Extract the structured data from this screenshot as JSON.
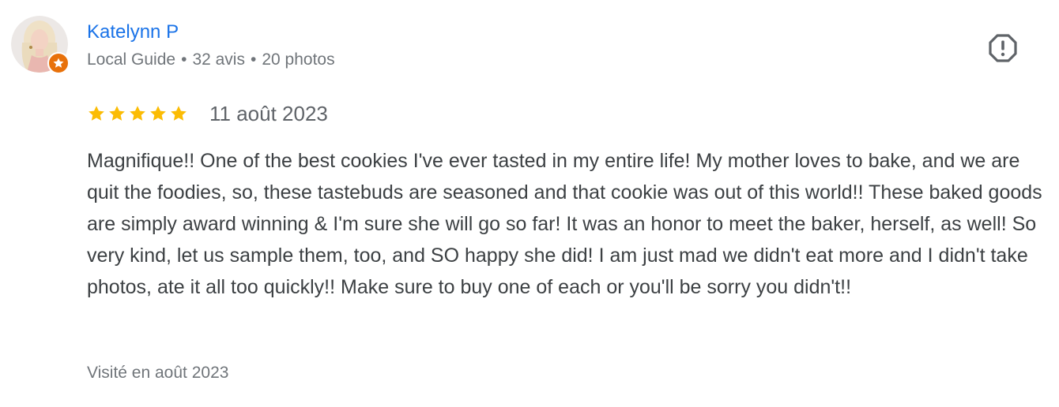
{
  "author": {
    "name": "Katelynn P",
    "meta": {
      "badge": "Local Guide",
      "reviews": "32 avis",
      "photos": "20 photos",
      "separator": "•"
    },
    "avatar_icon": "user-avatar-photo",
    "badge_icon": "local-guide-star-icon",
    "badge_color": "#e8710a"
  },
  "review": {
    "rating": 5,
    "max_rating": 5,
    "star_color": "#fbbc04",
    "date": "11 août 2023",
    "text": "Magnifique!! One of the best cookies I've ever tasted in my entire life! My mother loves to bake, and we are quit the foodies, so, these tastebuds are seasoned and that cookie was out of this world!! These baked goods are simply award winning & I'm sure she will go so far! It was an honor to meet the baker, herself, as well! So very kind, let us sample them, too, and SO happy she did! I am just mad we didn't eat more and I didn't take photos, ate it all too quickly!! Make sure to buy one of each or you'll be sorry you didn't!!",
    "visited": "Visité en août 2023"
  },
  "actions": {
    "flag_icon": "report-flag-icon"
  },
  "colors": {
    "link": "#1a73e8",
    "meta": "#70757a",
    "text": "#3c4043"
  }
}
